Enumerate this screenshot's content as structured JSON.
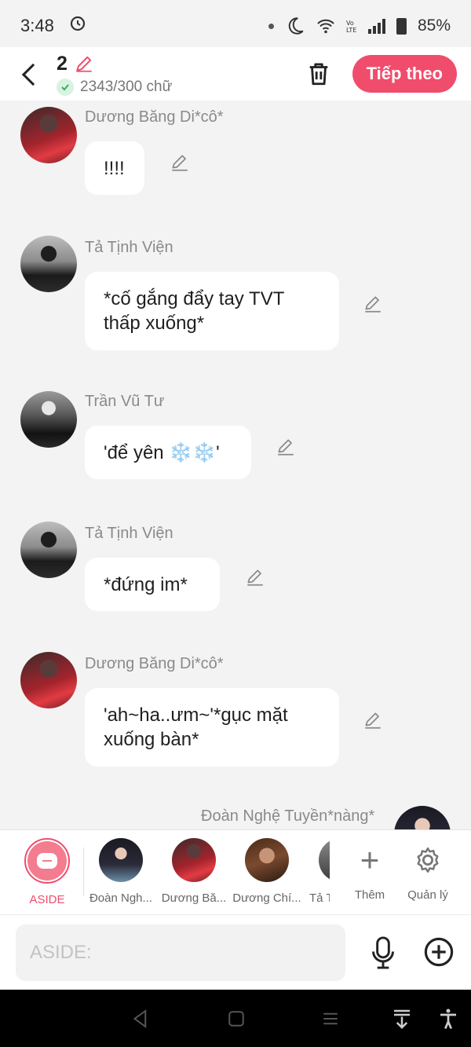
{
  "status_bar": {
    "time": "3:48",
    "battery": "85%",
    "icons": [
      "alarm-night-icon",
      "dnd-moon-icon",
      "wifi-icon",
      "volte-icon",
      "signal-icon",
      "battery-icon"
    ]
  },
  "header": {
    "count": "2",
    "word_count": "2343/300 chữ",
    "next_label": "Tiếp theo"
  },
  "messages": [
    {
      "sender": "Dương Băng Di*cô*",
      "text": "!!!!"
    },
    {
      "sender": "Tả Tịnh Viện",
      "text": "*cố gắng đẩy tay TVT thấp xuống*"
    },
    {
      "sender": "Trần Vũ Tư",
      "text": "'để yên ❄️❄️'"
    },
    {
      "sender": "Tả Tịnh Viện",
      "text": "*đứng im*"
    },
    {
      "sender": "Dương Băng Di*cô*",
      "text": "'ah~ha..ưm~'*gục mặt xuống bàn*"
    },
    {
      "sender": "Đoàn Nghệ Tuyền*nàng*",
      "text": ""
    }
  ],
  "characters": [
    {
      "label": "ASIDE"
    },
    {
      "label": "Đoàn Ngh..."
    },
    {
      "label": "Dương Bă..."
    },
    {
      "label": "Dương Chí..."
    },
    {
      "label": "Tả T"
    }
  ],
  "actions": {
    "add_label": "Thêm",
    "manage_label": "Quản lý"
  },
  "input": {
    "placeholder": "ASIDE:"
  },
  "colors": {
    "accent": "#f04d6d",
    "bubble": "#ffffff",
    "background": "#f3f3f3"
  }
}
